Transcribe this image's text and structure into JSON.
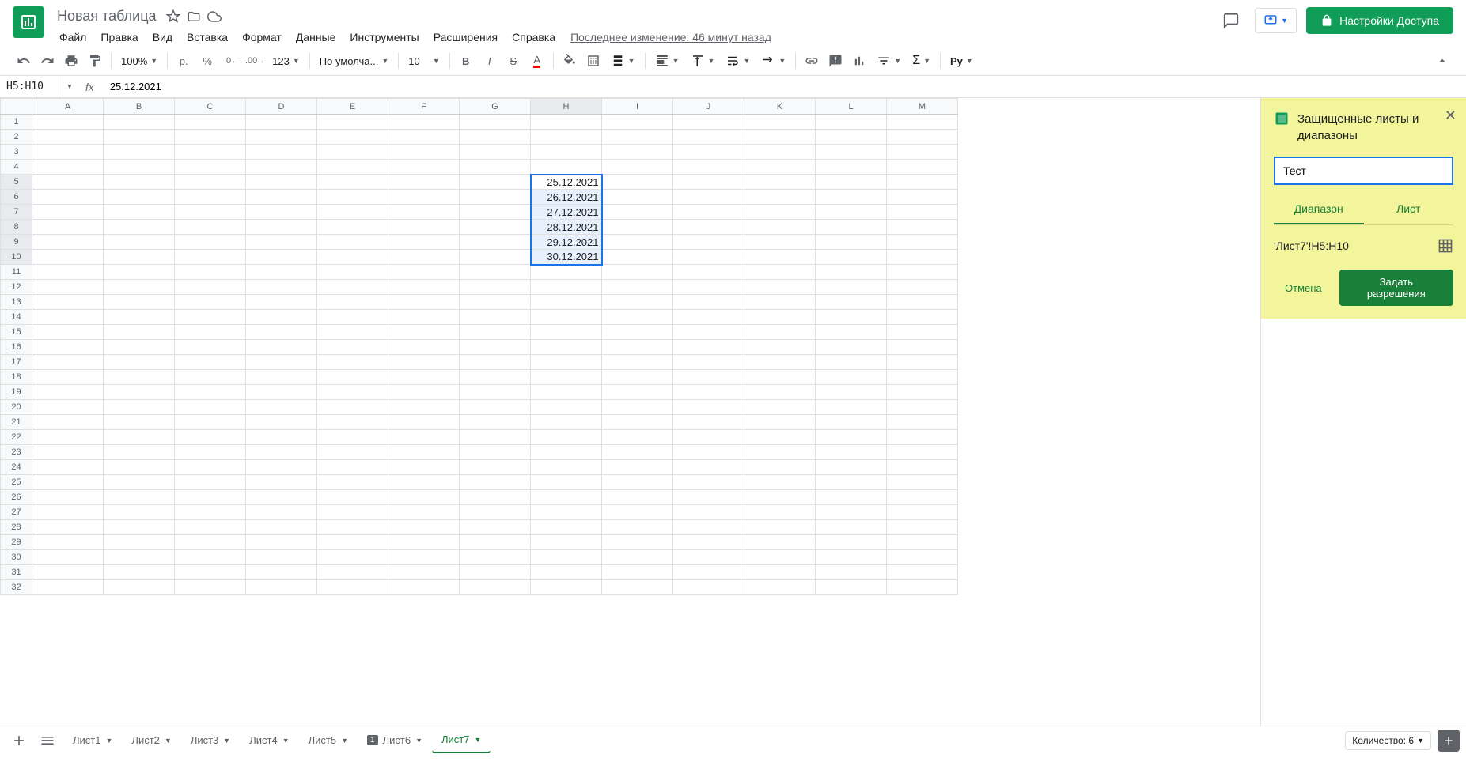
{
  "doc_title": "Новая таблица",
  "menu": {
    "file": "Файл",
    "edit": "Правка",
    "view": "Вид",
    "insert": "Вставка",
    "format": "Формат",
    "data": "Данные",
    "tools": "Инструменты",
    "extensions": "Расширения",
    "help": "Справка"
  },
  "last_edit": "Последнее изменение: 46 минут назад",
  "share_button": "Настройки Доступа",
  "toolbar": {
    "zoom": "100%",
    "currency": "р.",
    "percent": "%",
    "dec_dec": ".0",
    "dec_inc": ".00",
    "num_format": "123",
    "font": "По умолча...",
    "font_size": "10",
    "cyrillic": "Ру"
  },
  "name_box": "H5:H10",
  "formula_value": "25.12.2021",
  "columns": [
    "A",
    "B",
    "C",
    "D",
    "E",
    "F",
    "G",
    "H",
    "I",
    "J",
    "K",
    "L",
    "M"
  ],
  "row_count": 32,
  "selection": {
    "col": 7,
    "row_start": 5,
    "row_end": 10,
    "active_row": 5
  },
  "cells": {
    "H5": "25.12.2021",
    "H6": "26.12.2021",
    "H7": "27.12.2021",
    "H8": "28.12.2021",
    "H9": "29.12.2021",
    "H10": "30.12.2021"
  },
  "sidebar": {
    "title": "Защищенные листы и диапазоны",
    "description_value": "Тест",
    "tab_range": "Диапазон",
    "tab_sheet": "Лист",
    "range_value": "'Лист7'!H5:H10",
    "cancel": "Отмена",
    "set_permissions": "Задать разрешения"
  },
  "sheet_tabs": [
    {
      "label": "Лист1",
      "active": false
    },
    {
      "label": "Лист2",
      "active": false
    },
    {
      "label": "Лист3",
      "active": false
    },
    {
      "label": "Лист4",
      "active": false
    },
    {
      "label": "Лист5",
      "active": false
    },
    {
      "label": "Лист6",
      "active": false,
      "badge": true
    },
    {
      "label": "Лист7",
      "active": true
    }
  ],
  "status": {
    "count_label": "Количество: 6"
  }
}
